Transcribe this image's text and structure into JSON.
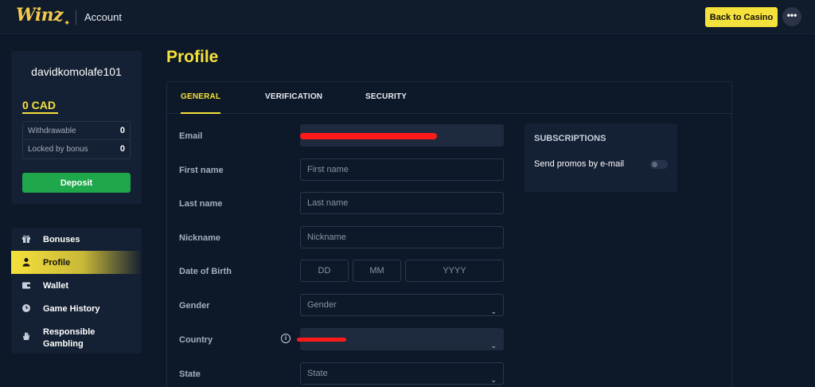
{
  "header": {
    "logo_text": "Winz",
    "title": "Account",
    "back_label": "Back to Casino",
    "more_label": "•••"
  },
  "user": {
    "username": "davidkomolafe101",
    "balance": "0 CAD",
    "withdrawable_label": "Withdrawable",
    "withdrawable_value": "0",
    "locked_label": "Locked by bonus",
    "locked_value": "0",
    "deposit_label": "Deposit"
  },
  "nav": {
    "items": [
      {
        "label": "Bonuses",
        "icon": "gift-icon"
      },
      {
        "label": "Profile",
        "icon": "user-icon"
      },
      {
        "label": "Wallet",
        "icon": "wallet-icon"
      },
      {
        "label": "Game History",
        "icon": "clock-icon"
      },
      {
        "label": "Responsible Gambling",
        "icon": "hand-icon"
      }
    ],
    "active": "Profile"
  },
  "page": {
    "title": "Profile",
    "tabs": [
      "GENERAL",
      "VERIFICATION",
      "SECURITY"
    ],
    "active_tab": "GENERAL"
  },
  "form": {
    "email_label": "Email",
    "first_name_label": "First name",
    "first_name_placeholder": "First name",
    "last_name_label": "Last name",
    "last_name_placeholder": "Last name",
    "nickname_label": "Nickname",
    "nickname_placeholder": "Nickname",
    "dob_label": "Date of Birth",
    "dob_day": "DD",
    "dob_month": "MM",
    "dob_year": "YYYY",
    "gender_label": "Gender",
    "gender_value": "Gender",
    "country_label": "Country",
    "state_label": "State",
    "state_value": "State"
  },
  "subscriptions": {
    "title": "SUBSCRIPTIONS",
    "promo_label": "Send promos by e-mail",
    "promo_enabled": false
  },
  "colors": {
    "accent": "#f5e13b",
    "deposit": "#1fa84b",
    "redaction": "#ff1a1a",
    "background": "#0d1828"
  }
}
